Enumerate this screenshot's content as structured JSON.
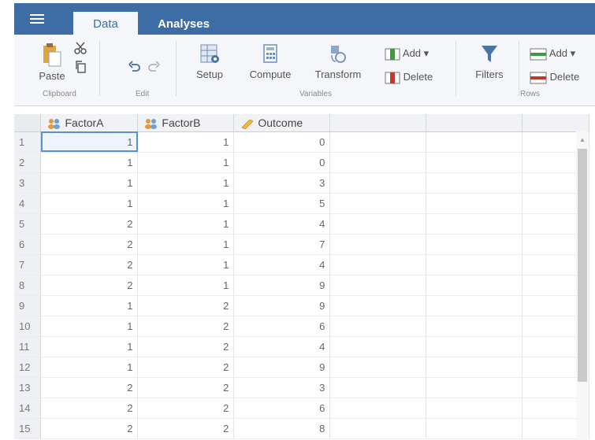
{
  "tabs": {
    "data": "Data",
    "analyses": "Analyses"
  },
  "ribbon": {
    "paste": "Paste",
    "clipboard": "Clipboard",
    "edit": "Edit",
    "setup": "Setup",
    "compute": "Compute",
    "transform": "Transform",
    "variables": "Variables",
    "add_var": "Add ▾",
    "delete_var": "Delete",
    "filters": "Filters",
    "add_row": "Add ▾",
    "delete_row": "Delete",
    "rows": "Rows"
  },
  "columns": [
    "FactorA",
    "FactorB",
    "Outcome"
  ],
  "column_icons": [
    "nominal-variable-icon",
    "nominal-variable-icon",
    "continuous-variable-icon"
  ],
  "rows": [
    [
      "1",
      "1",
      "1",
      "0"
    ],
    [
      "2",
      "1",
      "1",
      "0"
    ],
    [
      "3",
      "1",
      "1",
      "3"
    ],
    [
      "4",
      "1",
      "1",
      "5"
    ],
    [
      "5",
      "2",
      "1",
      "4"
    ],
    [
      "6",
      "2",
      "1",
      "7"
    ],
    [
      "7",
      "2",
      "1",
      "4"
    ],
    [
      "8",
      "2",
      "1",
      "9"
    ],
    [
      "9",
      "1",
      "2",
      "9"
    ],
    [
      "10",
      "1",
      "2",
      "6"
    ],
    [
      "11",
      "1",
      "2",
      "4"
    ],
    [
      "12",
      "1",
      "2",
      "9"
    ],
    [
      "13",
      "2",
      "2",
      "3"
    ],
    [
      "14",
      "2",
      "2",
      "6"
    ],
    [
      "15",
      "2",
      "2",
      "8"
    ]
  ],
  "colors": {
    "header_blue": "#3e6da6",
    "ribbon_bg": "#f4f6f9",
    "selection_outline": "#5b8fd0"
  }
}
